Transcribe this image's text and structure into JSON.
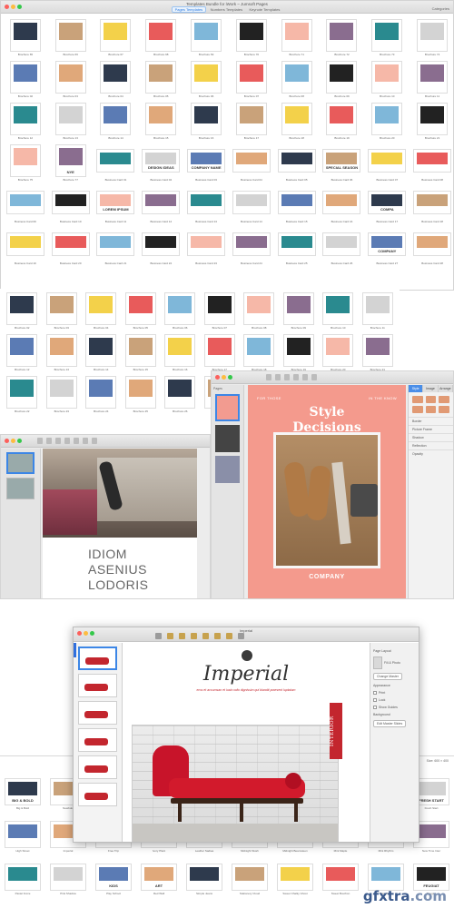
{
  "main_window": {
    "title": "Templates Bundle for iWork – Jumsoft Pages",
    "tabs": [
      "Pages Templates",
      "Numbers Templates",
      "Keynote Templates"
    ],
    "active_tab": 0,
    "categories_label": "Categories",
    "tiles": [
      "Brochure 65",
      "Brochure 66",
      "Brochure 67",
      "Brochure 68",
      "Brochure 69",
      "Brochure 70",
      "Brochure 71",
      "Brochure 72",
      "Brochure 73",
      "Brochure 74",
      "Brochure 02",
      "Brochure 03",
      "Brochure 04",
      "Brochure 05",
      "Brochure 06",
      "Brochure 07",
      "Brochure 08",
      "Brochure 09",
      "Brochure 10",
      "Brochure 11",
      "Brochure 12",
      "Brochure 13",
      "Brochure 14",
      "Brochure 15",
      "Brochure 16",
      "Brochure 17",
      "Brochure 18",
      "Brochure 19",
      "Brochure 20",
      "Brochure 21",
      "Brochure 75",
      "Brochure 77",
      "Business Card 01",
      "Business Card 02",
      "Business Card 03",
      "Business Card 04",
      "Business Card 05",
      "Business Card 06",
      "Business Card 07",
      "Business Card 08",
      "Business Card 09",
      "Business Card 10",
      "Business Card 11",
      "Business Card 12",
      "Business Card 13",
      "Business Card 14",
      "Business Card 15",
      "Business Card 16",
      "Business Card 17",
      "Business Card 18",
      "Business Card 19",
      "Business Card 20",
      "Business Card 21",
      "Business Card 22",
      "Business Card 23",
      "Business Card 24",
      "Business Card 25",
      "Business Card 26",
      "Business Card 27",
      "Business Card 28"
    ],
    "tile_texts": {
      "nye": "NYE",
      "design_ideas": "DESIGN IDEAS",
      "company_name": "COMPANY NAME",
      "special_season": "SPECIAL SEASON",
      "lorem_ipsum": "LOREM IPSUM",
      "company": "COMPANY",
      "compa": "COMPA"
    }
  },
  "second_window": {
    "tiles": [
      "Brochure 02",
      "Brochure 03",
      "Brochure 04",
      "Brochure 05",
      "Brochure 06",
      "Brochure 07",
      "Brochure 08",
      "Brochure 09",
      "Brochure 10",
      "Brochure 11",
      "Brochure 12",
      "Brochure 13",
      "Brochure 14",
      "Brochure 15",
      "Brochure 16",
      "Brochure 17",
      "Brochure 18",
      "Brochure 19",
      "Brochure 20",
      "Brochure 21",
      "Brochure 22",
      "Brochure 23",
      "Brochure 24",
      "Brochure 25",
      "Brochure 26",
      "Brochure 27",
      "Brochure 28",
      "Brochure 29",
      "Brochure 30",
      "Brochure 31"
    ]
  },
  "idiom_doc": {
    "lines": [
      "IDIOM",
      "ASENIUS",
      "LODORIS"
    ]
  },
  "style_doc": {
    "pages_label": "Pages",
    "left_tag": "FOR THOSE",
    "right_tag": "IN THE KNOW",
    "title_line1": "Style",
    "title_line2": "Decisions",
    "company": "COMPANY",
    "inspector_tabs": [
      "Style",
      "Image",
      "Arrange"
    ],
    "inspector_rows": [
      "Border",
      "Picture Frame",
      "Shadow",
      "Reflection",
      "Opacity"
    ]
  },
  "imperial_doc": {
    "window_title": "Imperial",
    "heading": "Imperial",
    "subheading": "eros et accumsan et iusto odio dignissim qui blandit praesent luptatum",
    "side_tag": "INTERIOR",
    "inspector": {
      "title": "Page Layout",
      "fill_label": "Fill & Photo",
      "change_master": "Change Master",
      "appearance_label": "Appearance",
      "options": [
        "Print",
        "Lock",
        "Show Guides"
      ],
      "background_label": "Background",
      "edit_btn": "Edit Master Slides"
    }
  },
  "bottom_strip": {
    "header": "Size: 600 × 400",
    "tiles": [
      "Big & Bold",
      "Newbold",
      "",
      "",
      "",
      "",
      "",
      "",
      "",
      "Fresh Start",
      "High Street",
      "Imperial",
      "Free Trip",
      "Ivory Plant",
      "Leather Sadiea",
      "Midnight Slush",
      "Midnight Beamsteen",
      "Mint Maple",
      "Mint Rhythm",
      "New Time Inter",
      "Pastel Force",
      "Pink Shadow",
      "Play School",
      "Red Wall",
      "Simple Jeans",
      "Stationery Cloud",
      "Sweet Chalky Ghost",
      "Sweet Bourbon",
      "Twin Tone",
      "Feugiat"
    ],
    "tile_texts": {
      "big_bold": "BIG & BOLD",
      "kids": "KIDS",
      "art": "ART",
      "fresh_start": "FRESH START",
      "feugiat": "FEUGIAT"
    }
  },
  "watermark": {
    "main": "gfxtra",
    "suffix": ".com"
  },
  "colors": {
    "accent": "#2f7de1",
    "style_pink": "#f49a8d",
    "imperial_red": "#c3262e"
  }
}
